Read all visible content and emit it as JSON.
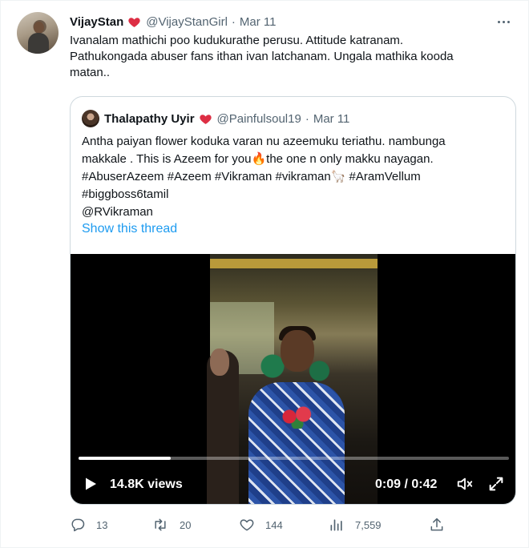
{
  "tweet": {
    "author_name": "VijayStan",
    "author_handle": "@VijayStanGirl",
    "separator": "·",
    "date": "Mar 11",
    "text_lines": [
      "Ivanalam mathichi poo kudukurathe perusu. Attitude katranam.",
      "Pathukongada abuser fans ithan ivan latchanam. Ungala mathika kooda",
      "matan.."
    ]
  },
  "quoted_tweet": {
    "author_name": "Thalapathy Uyir",
    "author_handle": "@Painfulsoul19",
    "date": "Mar 11",
    "text_lines": [
      "Antha paiyan flower koduka varan nu azeemuku teriathu. nambunga",
      "makkale . This is Azeem for you🔥the one n only makku nayagan.",
      "#AbuserAzeem #Azeem #Vikraman #vikraman🦙 #AramVellum",
      "#biggboss6tamil",
      "@RVikraman"
    ],
    "show_thread": "Show this thread"
  },
  "video": {
    "views": "14.8K views",
    "time": "0:09 / 0:42",
    "progress": 0.214
  },
  "actions": {
    "replies": "13",
    "retweets": "20",
    "likes": "144",
    "views": "7,559"
  },
  "colors": {
    "accent": "#1d9bf0",
    "heart": "#f91880",
    "secondary_text": "#536471"
  },
  "icons": [
    "more-icon",
    "heart-emoji-icon",
    "play-icon",
    "volume-icon",
    "fullscreen-icon",
    "reply-icon",
    "retweet-icon",
    "like-icon",
    "views-icon",
    "share-icon"
  ]
}
